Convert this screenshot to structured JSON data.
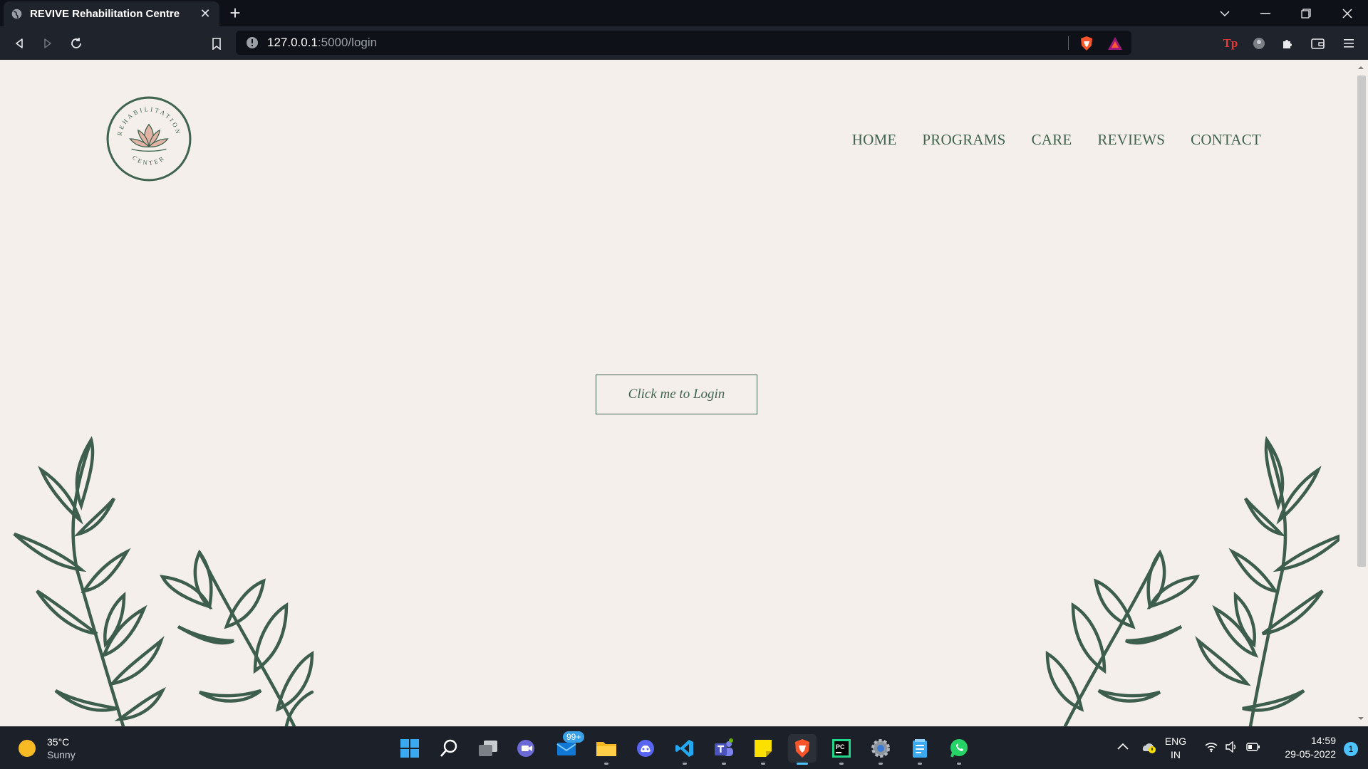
{
  "browser": {
    "tab_title": "REVIVE Rehabilitation Centre",
    "url_host": "127.0.0.1",
    "url_path": ":5000/login"
  },
  "site": {
    "logo_text_top": "REHABILITATION",
    "logo_text_bottom": "CENTER",
    "nav": [
      "HOME",
      "PROGRAMS",
      "CARE",
      "REVIEWS",
      "CONTACT"
    ],
    "login_button": "Click me to Login",
    "colors": {
      "accent": "#40644f",
      "background": "#f4efea",
      "lotus": "#e3b3a6"
    }
  },
  "taskbar": {
    "weather_temp": "35°C",
    "weather_desc": "Sunny",
    "mail_badge": "99+",
    "lang_top": "ENG",
    "lang_bottom": "IN",
    "time": "14:59",
    "date": "29-05-2022",
    "notification_count": "1"
  }
}
